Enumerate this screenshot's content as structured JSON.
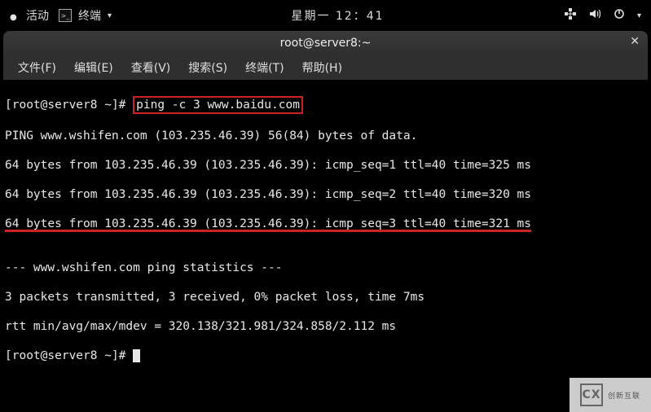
{
  "panel": {
    "activities_label": "活动",
    "app_label": "终端",
    "clock": "星期一 12：41"
  },
  "window": {
    "title": "root@server8:~"
  },
  "menubar": {
    "file": "文件(F)",
    "edit": "编辑(E)",
    "view": "查看(V)",
    "search": "搜索(S)",
    "terminal": "终端(T)",
    "help": "帮助(H)"
  },
  "terminal": {
    "prompt1": "[root@server8 ~]# ",
    "cmd_highlight": "ping -c 3 www.baidu.com",
    "out1": "PING www.wshifen.com (103.235.46.39) 56(84) bytes of data.",
    "out2": "64 bytes from 103.235.46.39 (103.235.46.39): icmp_seq=1 ttl=40 time=325 ms",
    "out3": "64 bytes from 103.235.46.39 (103.235.46.39): icmp_seq=2 ttl=40 time=320 ms",
    "out4": "64 bytes from 103.235.46.39 (103.235.46.39): icmp_seq=3 ttl=40 time=321 ms",
    "blank": "",
    "out5": "--- www.wshifen.com ping statistics ---",
    "out6": "3 packets transmitted, 3 received, 0% packet loss, time 7ms",
    "out7": "rtt min/avg/max/mdev = 320.138/321.981/324.858/2.112 ms",
    "prompt2": "[root@server8 ~]# "
  },
  "watermark": {
    "logo": "CX",
    "text": "创新互联"
  }
}
